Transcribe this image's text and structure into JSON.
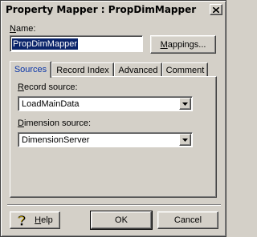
{
  "window": {
    "title": "Property Mapper : PropDimMapper"
  },
  "name": {
    "label": "Name:",
    "value": "PropDimMapper"
  },
  "buttons": {
    "mappings": "Mappings...",
    "help": "Help",
    "ok": "OK",
    "cancel": "Cancel"
  },
  "tabs": [
    {
      "label": "Sources",
      "active": true
    },
    {
      "label": "Record Index"
    },
    {
      "label": "Advanced"
    },
    {
      "label": "Comment"
    }
  ],
  "sources": {
    "record_source_label": "Record source:",
    "record_source_value": "LoadMainData",
    "dimension_source_label": "Dimension source:",
    "dimension_source_value": "DimensionServer"
  },
  "colors": {
    "face": "#d4d0c8",
    "selection": "#0a246a",
    "active_tab_text": "#0a35a8"
  },
  "icons": {
    "close": "close-icon",
    "help": "help-icon",
    "dropdown": "chevron-down-icon"
  }
}
